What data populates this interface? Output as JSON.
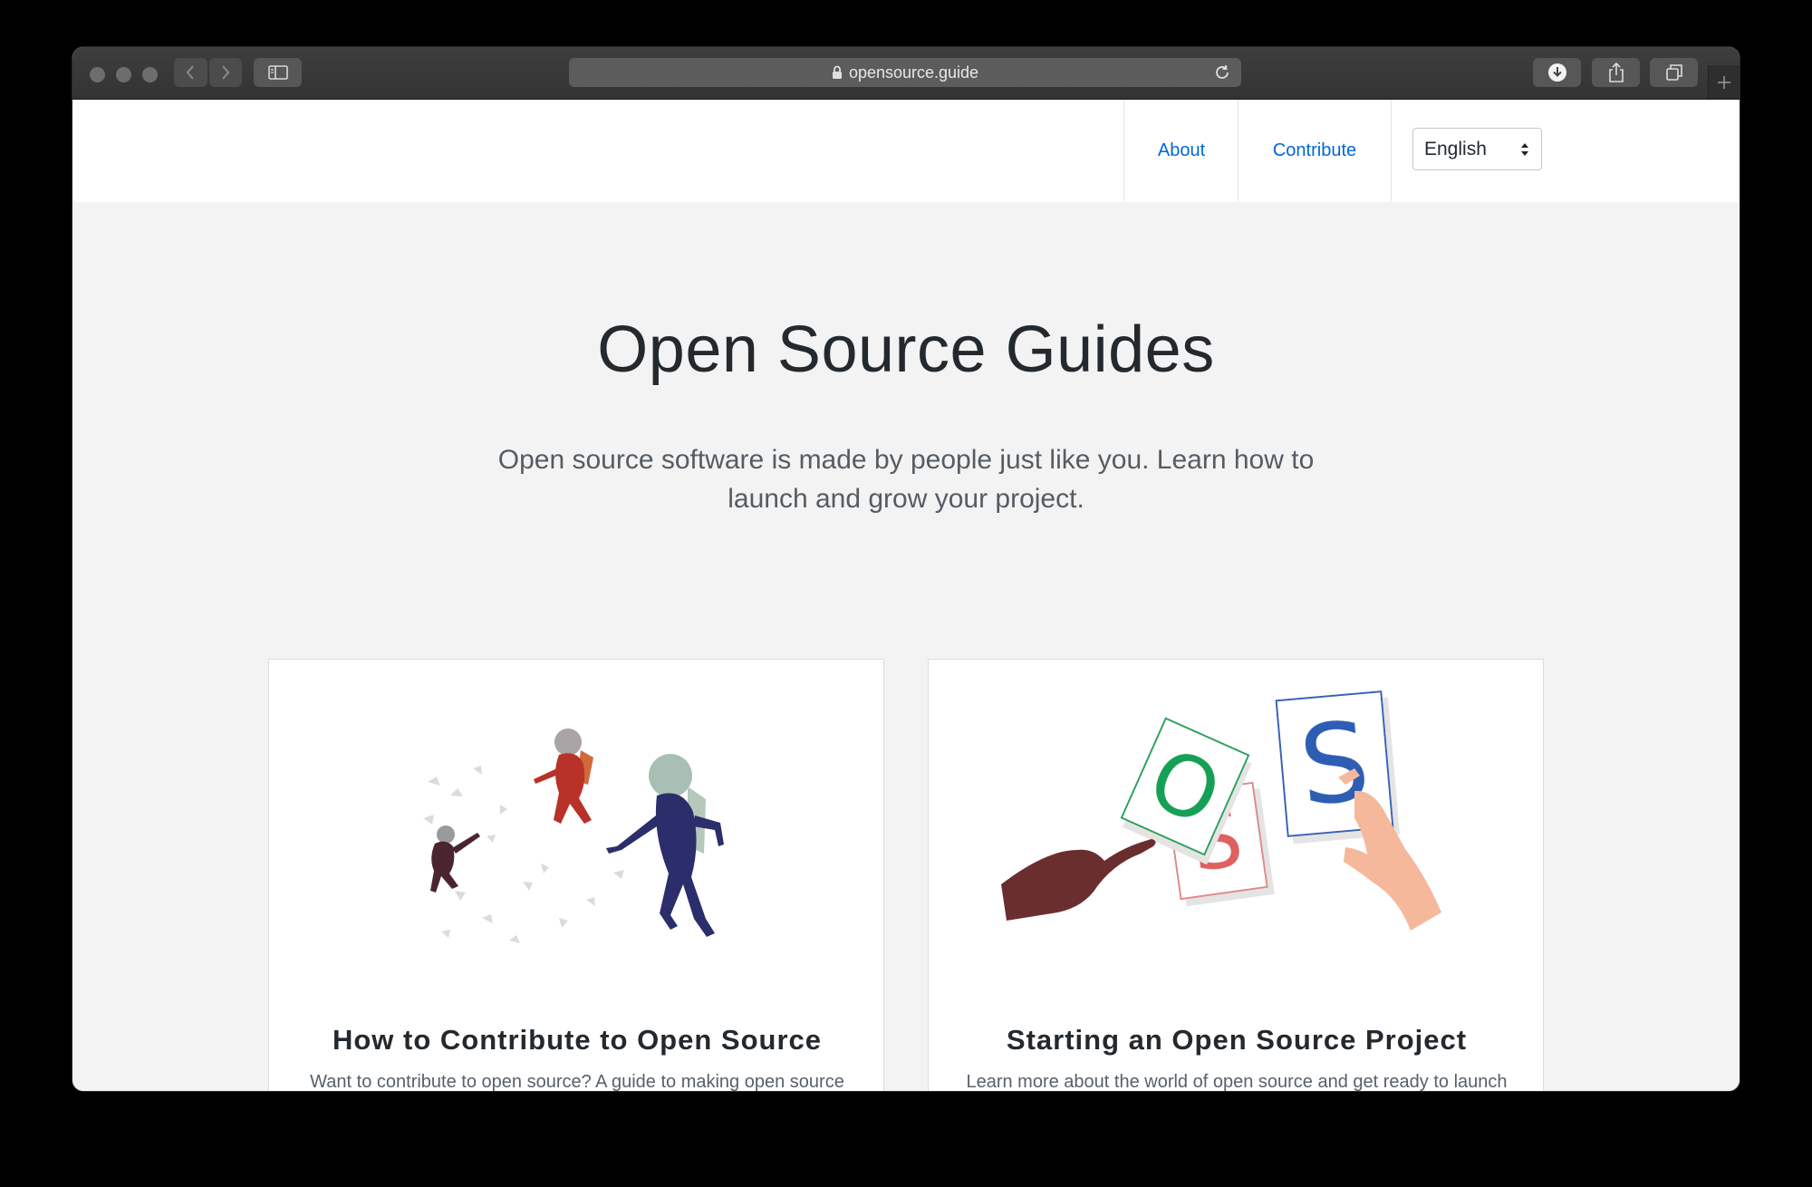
{
  "browser": {
    "url": "opensource.guide",
    "icons": [
      "back-icon",
      "forward-icon",
      "sidebar-icon",
      "lock-icon",
      "reload-icon",
      "download-icon",
      "share-icon",
      "tabs-icon",
      "new-tab-icon"
    ]
  },
  "header": {
    "nav": [
      {
        "label": "About"
      },
      {
        "label": "Contribute"
      }
    ],
    "language": "English"
  },
  "hero": {
    "title": "Open Source Guides",
    "subtitle": "Open source software is made by people just like you. Learn how to launch and grow your project."
  },
  "cards": [
    {
      "title": "How to Contribute to Open Source",
      "description": "Want to contribute to open source? A guide to making open source contributions, for first-timers and for veterans."
    },
    {
      "title": "Starting an Open Source Project",
      "description": "Learn more about the world of open source and get ready to launch your own project.",
      "letters": [
        "O",
        "S",
        "S"
      ]
    }
  ],
  "colors": {
    "link": "#0366d6",
    "title": "#24292e",
    "page_bg": "#f3f3f3"
  }
}
